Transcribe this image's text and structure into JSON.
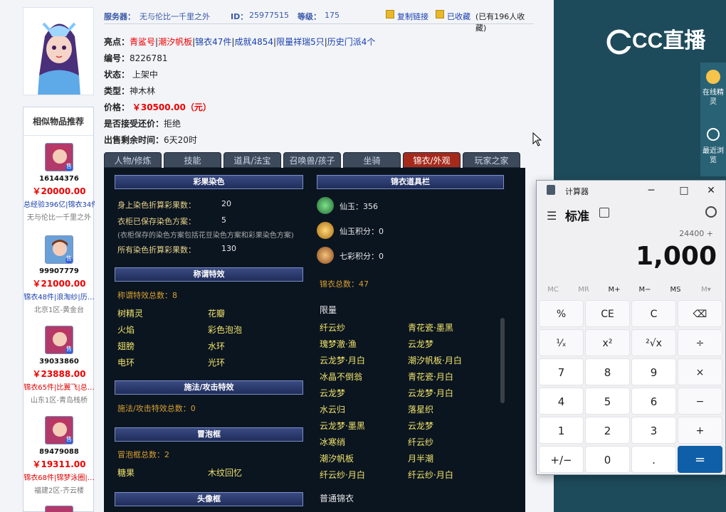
{
  "header": {
    "server_label": "服务器：",
    "server_value": "无与伦比一千里之外",
    "id_label": "ID：",
    "id_value": "25977515",
    "level_label": "等级：",
    "level_value": "175",
    "copy_link": "复制链接",
    "favorited": "已收藏",
    "fav_count_text": "(已有196人收藏)"
  },
  "details": {
    "highlights_label": "亮点：",
    "highlights": [
      "青鲨号",
      "潮汐帆板",
      "锦衣47件",
      "成就4854",
      "限量祥瑞5只",
      "历史门派4个"
    ],
    "number_label": "编号：",
    "number_value": "8226781",
    "status_label": "状态：",
    "status_value": "上架中",
    "type_label": "类型：",
    "type_value": "神木林",
    "price_label": "价格：",
    "price_value": "￥30500.00（元）",
    "counter_label": "是否接受还价：",
    "counter_value": "拒绝",
    "remaining_label": "出售剩余时间：",
    "remaining_value": "6天20时"
  },
  "similar": {
    "title": "相似物品推荐",
    "items": [
      {
        "id": "16144376",
        "price": "￥20000.00",
        "tags": "总经验396亿|锦衣34件",
        "server": "无与伦比一千里之外"
      },
      {
        "id": "99907779",
        "price": "￥21000.00",
        "tags": "锦衣48件|浪淘纱|历…",
        "server": "北京1区-黄金台"
      },
      {
        "id": "39033860",
        "price": "￥23888.00",
        "tags": "锦衣65件|比翼飞|总…",
        "server": "山东1区-青岛栈桥"
      },
      {
        "id": "89479088",
        "price": "￥19311.00",
        "tags": "锦衣68件|锦梦泳圈|…",
        "server": "福建2区-齐云楼"
      }
    ],
    "badge": "售"
  },
  "tabs": [
    "人物/修炼",
    "技能",
    "道具/法宝",
    "召唤兽/孩子",
    "坐骑",
    "锦衣/外观",
    "玩家之家"
  ],
  "panel": {
    "sec_dye": "彩果染色",
    "dye_rows": [
      {
        "label": "身上染色折算彩果数：",
        "value": "20"
      },
      {
        "label": "衣柜已保存染色方案：",
        "value": "5"
      },
      {
        "label": "所有染色折算彩果数：",
        "value": "130"
      }
    ],
    "dye_note": "(衣柜保存的染色方案包括花豆染色方案和彩果染色方案)",
    "sec_title": "称谓特效",
    "title_count": "称谓特效总数：8",
    "title_items": [
      "树精灵",
      "花瓣",
      "火焰",
      "彩色泡泡",
      "翅膀",
      "水环",
      "电环",
      "光环"
    ],
    "sec_spell": "施法/攻击特效",
    "spell_count": "施法/攻击特效总数：0",
    "sec_bubble": "冒泡框",
    "bubble_count": "冒泡框总数：2",
    "bubble_items": [
      "糖果",
      "木纹回忆"
    ],
    "sec_avatar": "头像框",
    "sec_jinyi": "锦衣道具栏",
    "currencies": [
      {
        "label": "仙玉：356",
        "color": "#2a8a4a"
      },
      {
        "label": "仙玉积分：0",
        "color": "#c98a1e"
      },
      {
        "label": "七彩积分：0",
        "color": "#c97a3e"
      }
    ],
    "jinyi_total": "锦衣总数：47",
    "limited_label": "限量",
    "limited_items": [
      "纤云纱",
      "青花瓷·墨黑",
      "瑰梦澈·渔",
      "云龙梦",
      "云龙梦·月白",
      "潮汐帆板·月白",
      "冰晶不倒翁",
      "青花瓷·月白",
      "云龙梦",
      "云龙梦·月白",
      "水云归",
      "落星织",
      "云龙梦·墨黑",
      "云龙梦",
      "冰寒绡",
      "纤云纱",
      "潮汐帆板",
      "月半潮",
      "纤云纱·月白",
      "纤云纱·月白"
    ],
    "normal_label": "普通锦衣"
  },
  "brand": {
    "logo_text": "CC直播",
    "online_btn": "在线精灵",
    "recent_btn": "最近浏览"
  },
  "calculator": {
    "title": "计算器",
    "mode": "标准",
    "expression": "24400 +",
    "display": "1,000",
    "memory": [
      "MC",
      "MR",
      "M+",
      "M−",
      "MS",
      "M▾"
    ],
    "keys": [
      "%",
      "CE",
      "C",
      "⌫",
      "¹⁄ₓ",
      "x²",
      "²√x",
      "÷",
      "7",
      "8",
      "9",
      "×",
      "4",
      "5",
      "6",
      "−",
      "1",
      "2",
      "3",
      "+",
      "+/−",
      "0",
      ".",
      "="
    ]
  }
}
